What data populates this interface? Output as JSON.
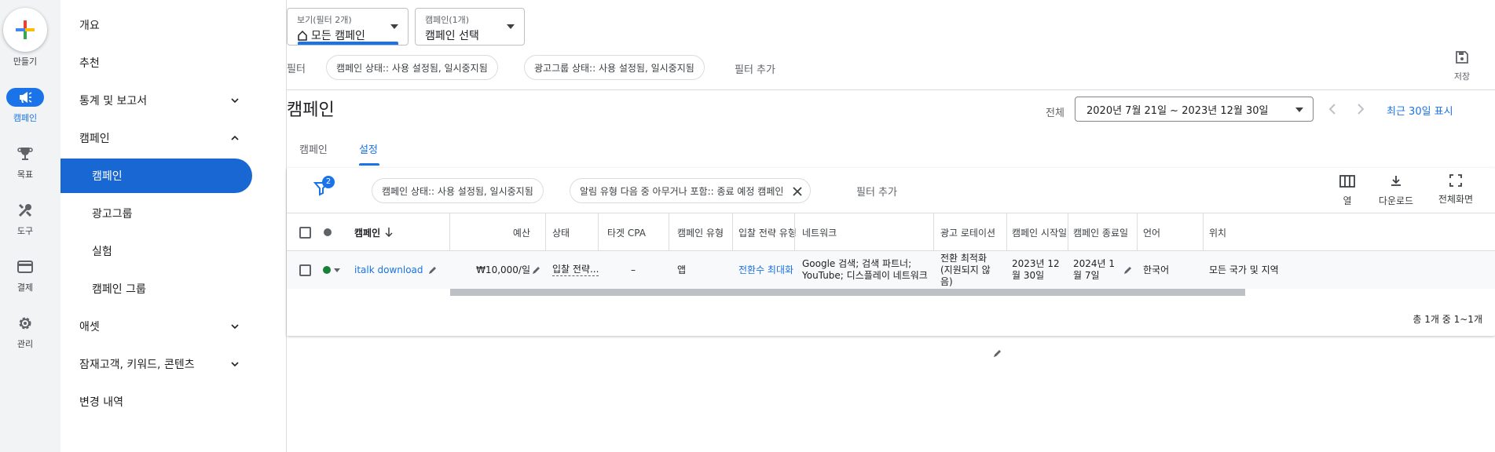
{
  "rail": {
    "create_label": "만들기",
    "items": [
      {
        "label": "캠페인",
        "icon": "megaphone-icon"
      },
      {
        "label": "목표",
        "icon": "trophy-icon"
      },
      {
        "label": "도구",
        "icon": "tools-icon"
      },
      {
        "label": "결제",
        "icon": "credit-card-icon"
      },
      {
        "label": "관리",
        "icon": "gear-icon"
      }
    ]
  },
  "nav": {
    "items": [
      {
        "label": "개요"
      },
      {
        "label": "추천"
      },
      {
        "label": "통계 및 보고서"
      },
      {
        "label": "캠페인"
      },
      {
        "label": "캠페인"
      },
      {
        "label": "광고그룹"
      },
      {
        "label": "실험"
      },
      {
        "label": "캠페인 그룹"
      },
      {
        "label": "애셋"
      },
      {
        "label": "잠재고객, 키워드, 콘텐츠"
      },
      {
        "label": "변경 내역"
      }
    ]
  },
  "header": {
    "view_selector": {
      "small": "보기(필터 2개)",
      "value": "모든 캠페인"
    },
    "campaign_selector": {
      "small": "캠페인(1개)",
      "value": "캠페인 선택"
    },
    "filter_label": "필터",
    "filter_chips": [
      "캠페인 상태:: 사용 설정됨, 일시중지됨",
      "광고그룹 상태:: 사용 설정됨, 일시중지됨"
    ],
    "add_filter": "필터 추가",
    "save_label": "저장"
  },
  "page": {
    "title": "캠페인",
    "range_label": "전체",
    "date_range": "2020년 7월 21일 ~ 2023년 12월 30일",
    "recent_link": "최근 30일 표시"
  },
  "tabs": [
    {
      "label": "캠페인",
      "active": false
    },
    {
      "label": "설정",
      "active": true
    }
  ],
  "table_toolbar": {
    "filter_count": "2",
    "chips": [
      "캠페인 상태:: 사용 설정됨, 일시중지됨",
      "알림 유형 다음 중 아무거나 포함:: 종료 예정 캠페인"
    ],
    "add_filter": "필터 추가",
    "columns_label": "열",
    "download_label": "다운로드",
    "fullscreen_label": "전체화면"
  },
  "table": {
    "headers": [
      "캠페인",
      "예산",
      "상태",
      "타겟 CPA",
      "캠페인 유형",
      "입찰 전략 유형",
      "네트워크",
      "광고 로테이션",
      "캠페인 시작일",
      "캠페인 종료일",
      "언어",
      "위치"
    ],
    "row": {
      "campaign": "italk download",
      "budget": "₩10,000/일",
      "status": "입찰 전략...",
      "target_cpa": "–",
      "type": "앱",
      "bid_strategy": "전환수 최대화",
      "network": "Google 검색; 검색 파트너; YouTube; 디스플레이 네트워크",
      "rotation": "전환 최적화 (지원되지 않음)",
      "start": "2023년 12월 30일",
      "end": "2024년 1월 7일",
      "language": "한국어",
      "location": "모든 국가 및 지역"
    },
    "footer": "총 1개 중 1~1개"
  },
  "colors": {
    "accent": "#1a73e8",
    "selected_nav": "#1967d2",
    "status_enabled": "#188038"
  }
}
